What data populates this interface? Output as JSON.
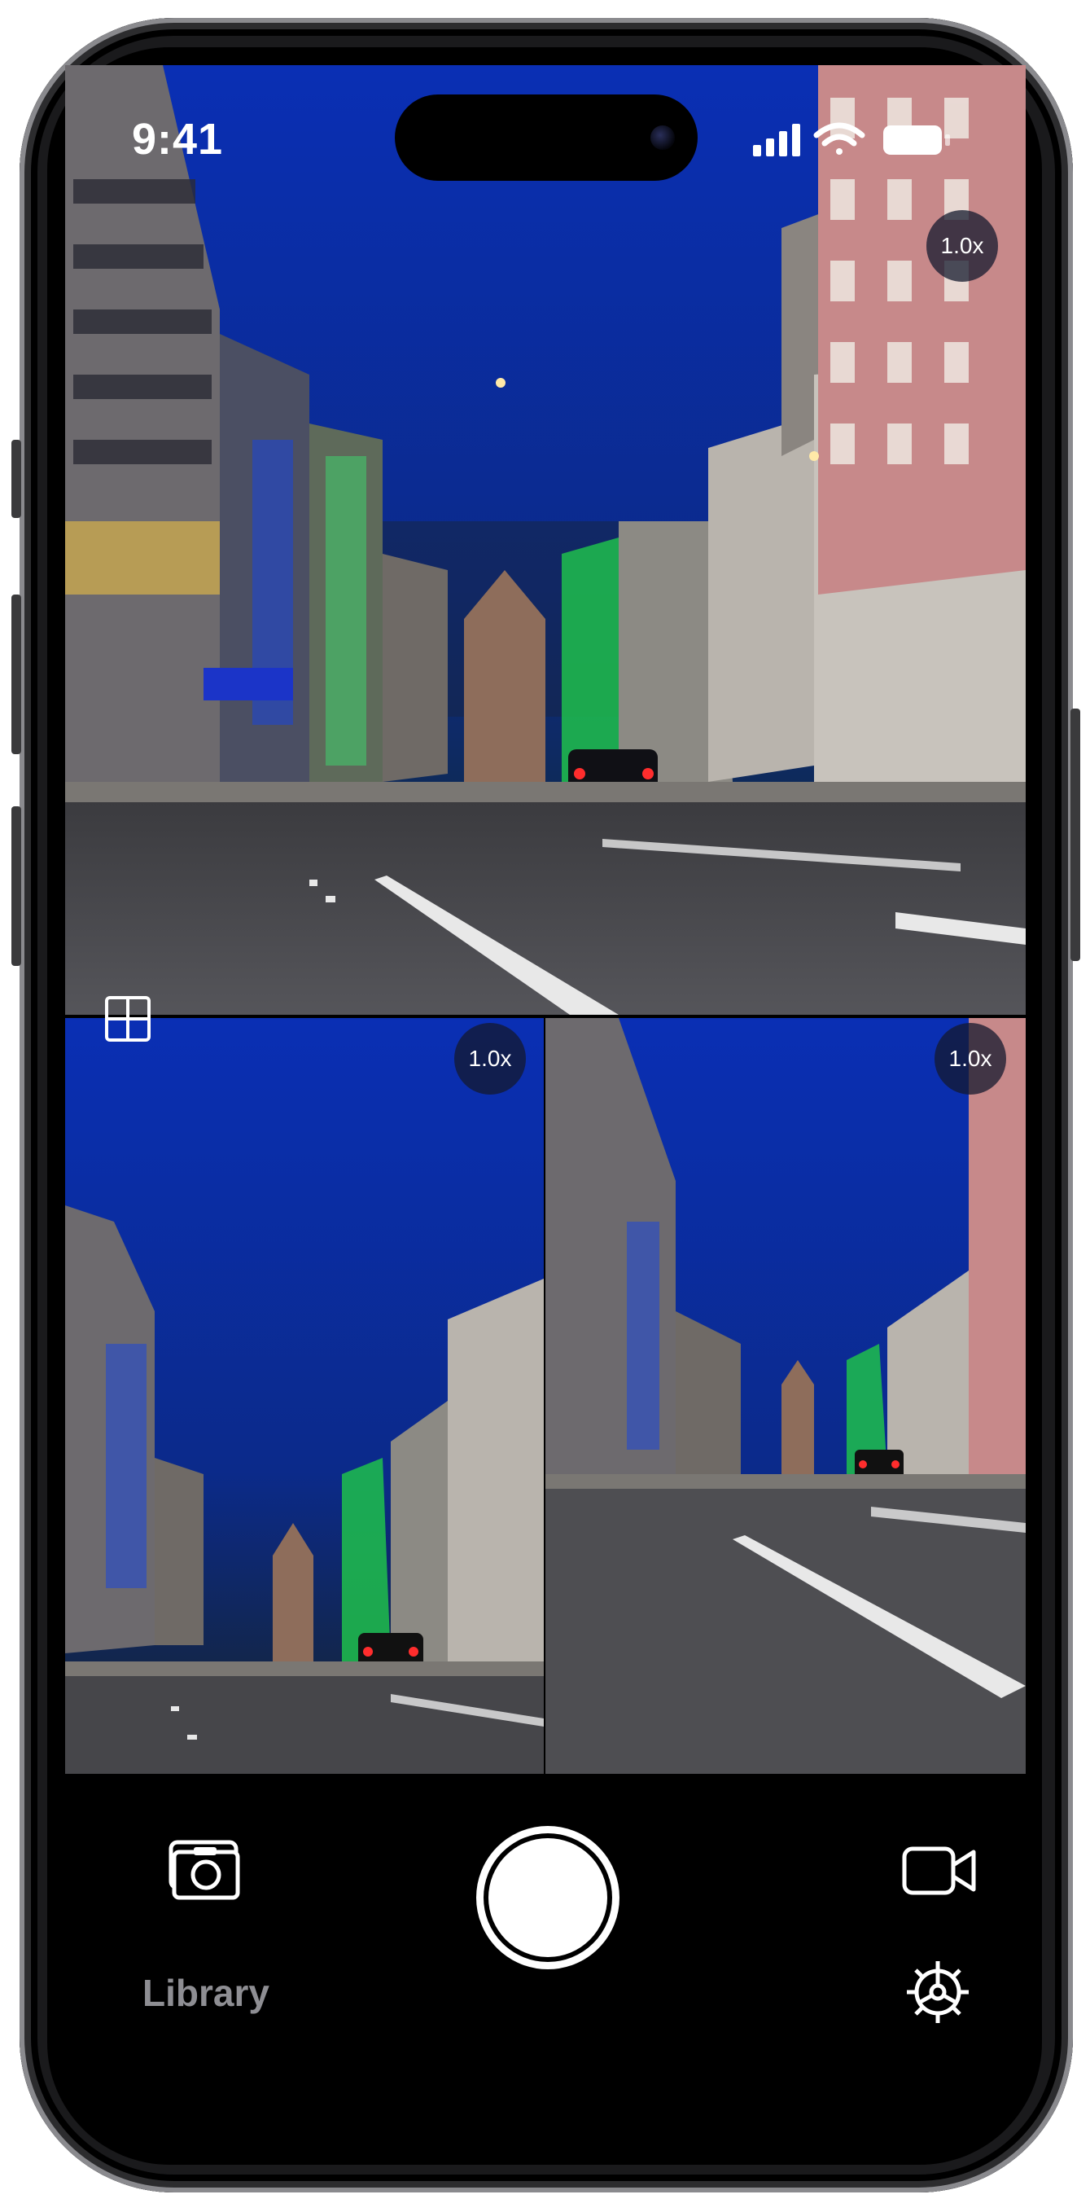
{
  "status_bar": {
    "time": "9:41"
  },
  "camera_views": [
    {
      "name": "main",
      "zoom": "1.0x"
    },
    {
      "name": "bottom-left",
      "zoom": "1.0x"
    },
    {
      "name": "bottom-right",
      "zoom": "1.0x"
    }
  ],
  "icons": {
    "layout": "grid-layout-icon",
    "photo": "camera-photo-icon",
    "video": "video-camera-icon",
    "settings": "gear-icon",
    "shutter": "shutter-button"
  },
  "bottom_bar": {
    "library_label": "Library"
  },
  "colors": {
    "sky": "#0b2a8a",
    "accent_label": "#8e8e93"
  }
}
